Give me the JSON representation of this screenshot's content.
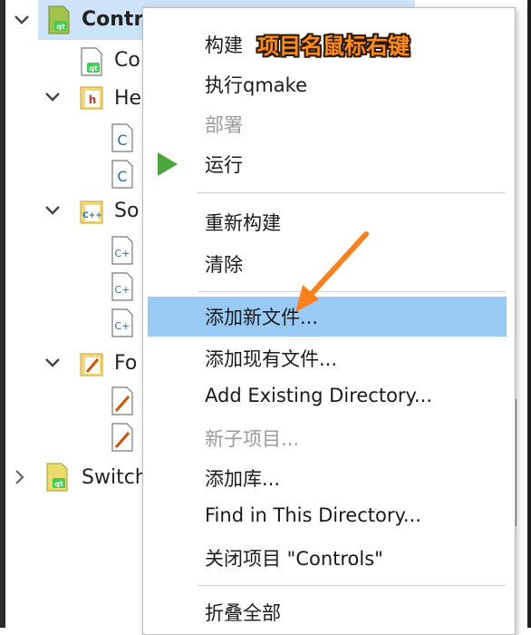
{
  "tree": {
    "items": [
      {
        "label": "Controls",
        "icon": "qt-project-icon",
        "expanded": true
      },
      {
        "label": "Co",
        "icon": "qt-pro-file-icon"
      },
      {
        "label": "He",
        "icon": "headers-folder-icon",
        "expanded": true
      },
      {
        "label": "",
        "icon": "c-header-file-icon"
      },
      {
        "label": "",
        "icon": "c-header-file-icon"
      },
      {
        "label": "So",
        "icon": "sources-folder-icon",
        "expanded": true
      },
      {
        "label": "",
        "icon": "cpp-source-file-icon"
      },
      {
        "label": "",
        "icon": "cpp-source-file-icon"
      },
      {
        "label": "",
        "icon": "cpp-source-file-icon"
      },
      {
        "label": "Fo",
        "icon": "forms-folder-icon",
        "expanded": true
      },
      {
        "label": "",
        "icon": "form-file-icon"
      },
      {
        "label": "",
        "icon": "form-file-icon"
      },
      {
        "label": "Switch",
        "icon": "qt-project-icon",
        "expanded": false
      }
    ]
  },
  "menu": {
    "items": [
      {
        "label": "构建",
        "enabled": true
      },
      {
        "label": "执行qmake",
        "enabled": true
      },
      {
        "label": "部署",
        "enabled": false
      },
      {
        "label": "运行",
        "enabled": true,
        "icon": "run-icon"
      },
      {
        "label": "重新构建",
        "enabled": true
      },
      {
        "label": "清除",
        "enabled": true
      },
      {
        "label": "添加新文件...",
        "enabled": true,
        "highlighted": true
      },
      {
        "label": "添加现有文件...",
        "enabled": true
      },
      {
        "label": "Add Existing Directory...",
        "enabled": true
      },
      {
        "label": "新子项目...",
        "enabled": false
      },
      {
        "label": "添加库...",
        "enabled": true
      },
      {
        "label": "Find in This Directory...",
        "enabled": true
      },
      {
        "label": "关闭项目 \"Controls\"",
        "enabled": true
      },
      {
        "label": "折叠全部",
        "enabled": true
      }
    ]
  },
  "annotation": {
    "text": "项目名鼠标右键",
    "color": "#ff8c1a"
  },
  "colors": {
    "highlight": "#99c9f5",
    "run_green": "#4aa63c",
    "tree_selection": "#cde3f7"
  }
}
